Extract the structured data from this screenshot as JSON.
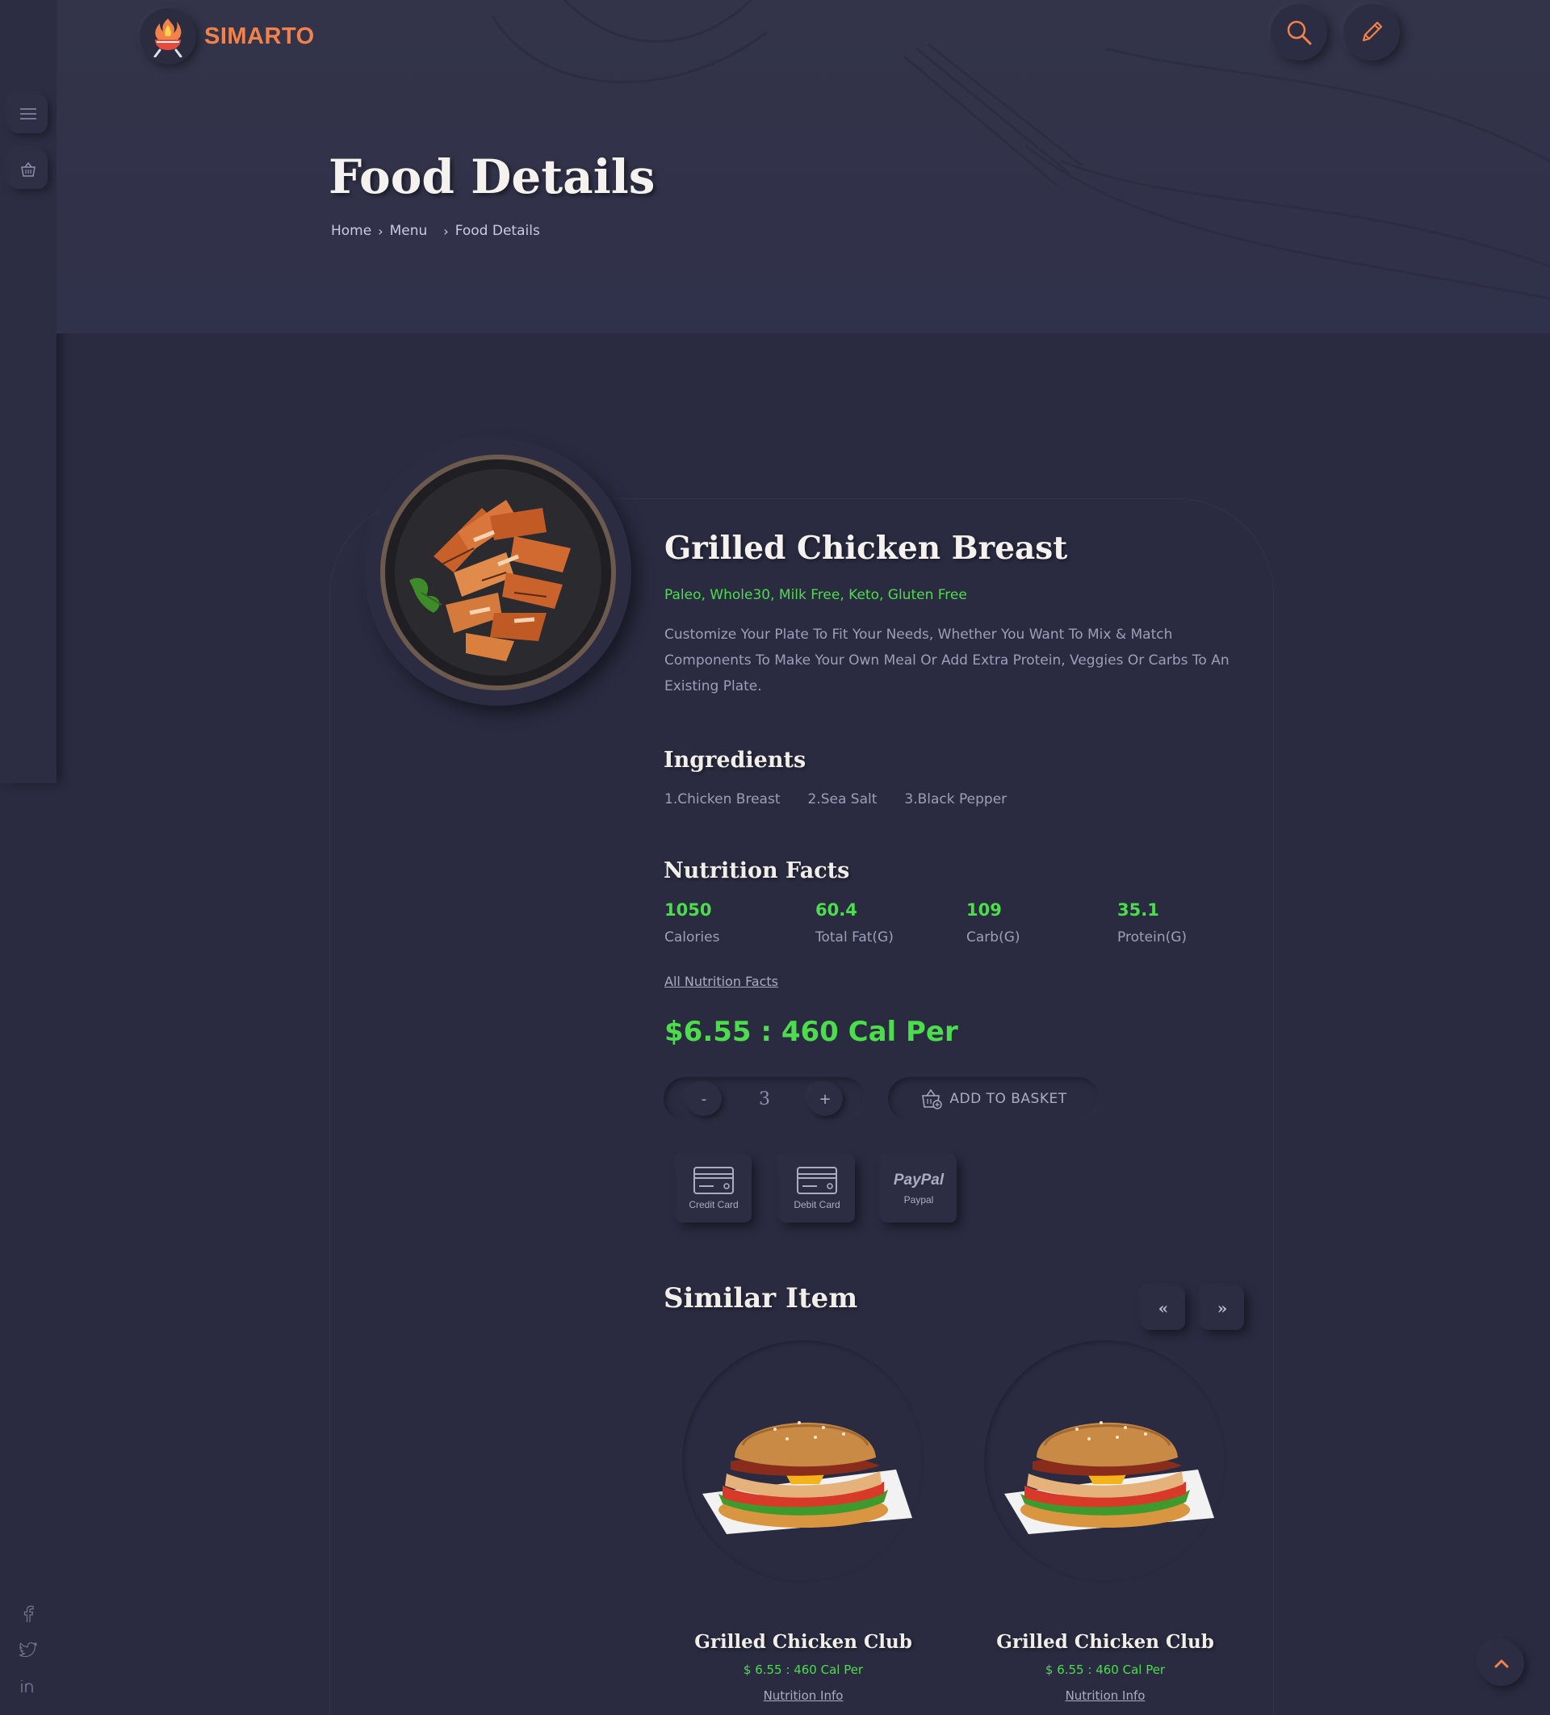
{
  "brand": {
    "name": "SIMARTO"
  },
  "header": {
    "title": "Food Details",
    "breadcrumb": [
      "Home",
      "Menu",
      "Food Details"
    ]
  },
  "sidebar": {
    "icons": [
      "menu-icon",
      "basket-icon"
    ],
    "social": [
      "facebook-icon",
      "twitter-icon",
      "linkedin-icon"
    ]
  },
  "top_actions": [
    "search-icon",
    "pencil-icon"
  ],
  "food": {
    "title": "Grilled Chicken Breast",
    "tags": "Paleo, Whole30, Milk Free, Keto, Gluten Free",
    "description": "Customize Your Plate To Fit Your Needs, Whether You Want To Mix & Match Components To Make Your Own Meal Or Add Extra Protein, Veggies Or Carbs To An Existing Plate."
  },
  "ingredients": {
    "heading": "Ingredients",
    "items": [
      "1.Chicken Breast",
      "2.Sea Salt",
      "3.Black Pepper"
    ]
  },
  "nutrition": {
    "heading": "Nutrition Facts",
    "items": [
      {
        "value": "1050",
        "label": "Calories"
      },
      {
        "value": "60.4",
        "label": "Total Fat(G)"
      },
      {
        "value": "109",
        "label": "Carb(G)"
      },
      {
        "value": "35.1",
        "label": "Protein(G)"
      }
    ],
    "link": "All Nutrition Facts"
  },
  "price": "$6.55 : 460 Cal Per",
  "quantity": {
    "minus": "-",
    "value": "3",
    "plus": "+"
  },
  "basket": {
    "label": "ADD TO BASKET"
  },
  "payments": [
    {
      "label": "Credit Card",
      "icon": "credit-card-icon"
    },
    {
      "label": "Debit Card",
      "icon": "debit-card-icon"
    },
    {
      "label": "Paypal",
      "icon": "paypal-icon",
      "brand": "PayPal"
    }
  ],
  "similar": {
    "heading": "Similar Item",
    "prev": "«",
    "next": "»",
    "items": [
      {
        "title": "Grilled Chicken Club",
        "price": "$ 6.55 : 460 Cal Per",
        "link": "Nutrition Info"
      },
      {
        "title": "Grilled Chicken Club",
        "price": "$ 6.55 : 460 Cal Per",
        "link": "Nutrition Info"
      }
    ]
  },
  "colors": {
    "background": "#2a2b40",
    "accent_orange": "#f2824a",
    "accent_green": "#4cdd4c",
    "text_muted": "#9c9fba"
  }
}
